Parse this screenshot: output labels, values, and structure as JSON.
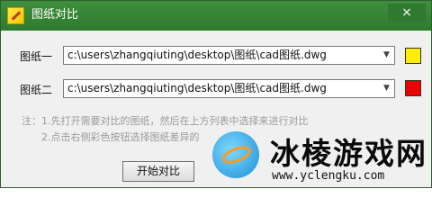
{
  "window": {
    "title": "图纸对比",
    "close_label": "×"
  },
  "rows": [
    {
      "label": "图纸一",
      "path": "c:\\users\\zhangqiuting\\desktop\\图纸\\cad图纸.dwg",
      "color": "#ffee00"
    },
    {
      "label": "图纸二",
      "path": "c:\\users\\zhangqiuting\\desktop\\图纸\\cad图纸.dwg",
      "color": "#ee0000"
    }
  ],
  "notes": {
    "line1": "注：1.先打开需要对比的图纸，然后在上方列表中选择来进行对比",
    "line2": "2.点击右侧彩色按钮选择图纸差异的"
  },
  "footer": {
    "start_label": "开始对比"
  },
  "watermark": {
    "title": "冰棱游戏网",
    "url": "www.yclengku.com"
  },
  "icons": {
    "dropdown": "chevron-down-icon",
    "close": "close-icon",
    "app": "app-logo-icon"
  }
}
